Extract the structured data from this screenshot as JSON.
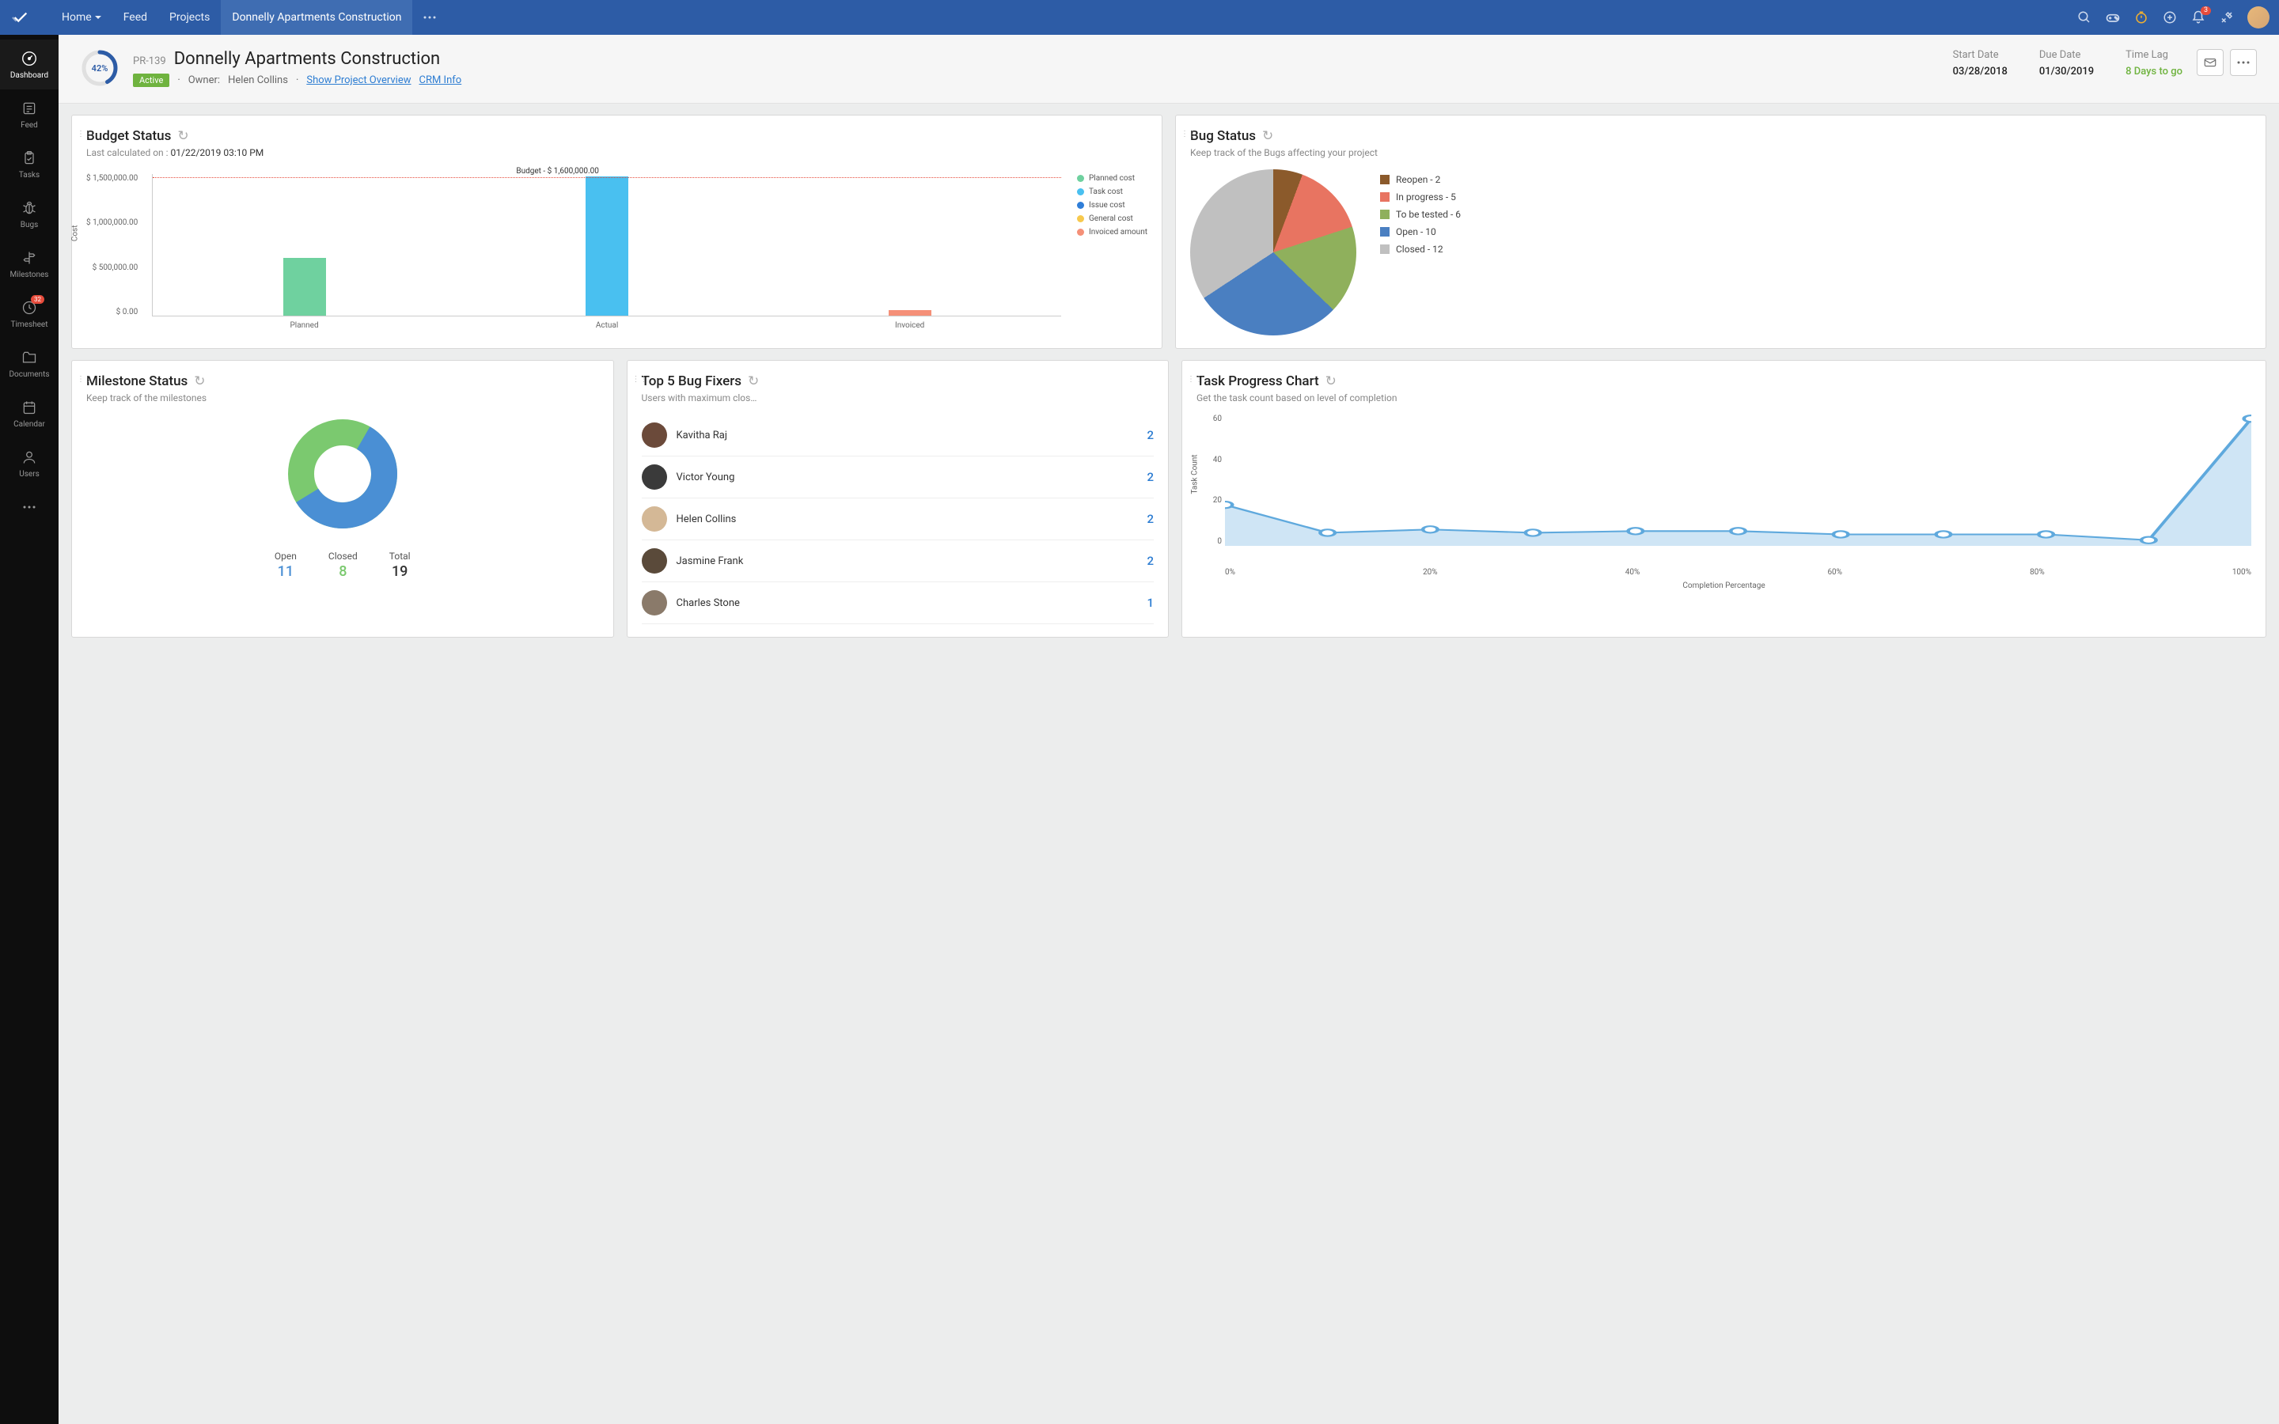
{
  "topbar": {
    "nav": [
      "Home",
      "Feed",
      "Projects",
      "Donnelly Apartments Construction"
    ],
    "notification_count": "3"
  },
  "sidebar": {
    "items": [
      {
        "label": "Dashboard",
        "icon": "gauge"
      },
      {
        "label": "Feed",
        "icon": "feed"
      },
      {
        "label": "Tasks",
        "icon": "clipboard"
      },
      {
        "label": "Bugs",
        "icon": "bug"
      },
      {
        "label": "Milestones",
        "icon": "signpost"
      },
      {
        "label": "Timesheet",
        "icon": "clock",
        "badge": "32"
      },
      {
        "label": "Documents",
        "icon": "folder"
      },
      {
        "label": "Calendar",
        "icon": "calendar"
      },
      {
        "label": "Users",
        "icon": "user"
      }
    ]
  },
  "project": {
    "progress_pct": "42%",
    "id": "PR-139",
    "title": "Donnelly Apartments Construction",
    "status": "Active",
    "owner_label": "Owner:",
    "owner_name": "Helen Collins",
    "overview_link": "Show Project Overview",
    "crm_link": "CRM Info",
    "start_label": "Start Date",
    "start_val": "03/28/2018",
    "due_label": "Due Date",
    "due_val": "01/30/2019",
    "lag_label": "Time Lag",
    "lag_val": "8 Days to go"
  },
  "budget": {
    "title": "Budget Status",
    "calc_prefix": "Last calculated on : ",
    "calc_time": "01/22/2019 03:10 PM",
    "budget_label": "Budget - $ 1,600,000.00",
    "ylabel": "Cost",
    "ticks": [
      "$ 1,500,000.00",
      "$ 1,000,000.00",
      "$ 500,000.00",
      "$ 0.00"
    ],
    "legend": [
      "Planned cost",
      "Task cost",
      "Issue cost",
      "General cost",
      "Invoiced amount"
    ],
    "legend_colors": [
      "#6fd19f",
      "#49c0f0",
      "#2f7ed8",
      "#f7c94d",
      "#f59078"
    ]
  },
  "bugstatus": {
    "title": "Bug Status",
    "sub": "Keep track of the Bugs affecting your project",
    "legend": [
      {
        "label": "Reopen - 2",
        "color": "#8b5a2b"
      },
      {
        "label": "In progress - 5",
        "color": "#e87461"
      },
      {
        "label": "To be tested - 6",
        "color": "#8fb05c"
      },
      {
        "label": "Open - 10",
        "color": "#4a7fc1"
      },
      {
        "label": "Closed - 12",
        "color": "#c0c0c0"
      }
    ]
  },
  "milestone": {
    "title": "Milestone Status",
    "sub": "Keep track of the milestones",
    "stats": [
      {
        "label": "Open",
        "value": "11",
        "cls": "blue"
      },
      {
        "label": "Closed",
        "value": "8",
        "cls": "green"
      },
      {
        "label": "Total",
        "value": "19",
        "cls": "dark"
      }
    ]
  },
  "fixers": {
    "title": "Top 5 Bug Fixers",
    "sub": "Users with maximum clos…",
    "rows": [
      {
        "name": "Kavitha Raj",
        "count": "2",
        "bg": "#6b4a3a"
      },
      {
        "name": "Victor Young",
        "count": "2",
        "bg": "#3a3a3a"
      },
      {
        "name": "Helen Collins",
        "count": "2",
        "bg": "#d4b896"
      },
      {
        "name": "Jasmine Frank",
        "count": "2",
        "bg": "#5a4a3a"
      },
      {
        "name": "Charles Stone",
        "count": "1",
        "bg": "#8a7a6a"
      }
    ]
  },
  "taskprogress": {
    "title": "Task Progress Chart",
    "sub": "Get the task count based on level of completion",
    "ylabel": "Task Count",
    "xlabel": "Completion Percentage",
    "yticks": [
      "60",
      "40",
      "20",
      "0"
    ],
    "xticks": [
      "0%",
      "20%",
      "40%",
      "60%",
      "80%",
      "100%"
    ]
  },
  "chart_data": [
    {
      "id": "budget_status",
      "type": "bar",
      "title": "Budget Status",
      "ylabel": "Cost",
      "ylim": [
        0,
        1600000
      ],
      "budget_line": 1600000,
      "categories": [
        "Planned",
        "Actual",
        "Invoiced"
      ],
      "values": [
        650000,
        1580000,
        60000
      ],
      "colors": [
        "#6fd19f",
        "#49c0f0",
        "#f59078"
      ],
      "legend": [
        "Planned cost",
        "Task cost",
        "Issue cost",
        "General cost",
        "Invoiced amount"
      ]
    },
    {
      "id": "bug_status",
      "type": "pie",
      "title": "Bug Status",
      "series": [
        {
          "name": "Reopen",
          "value": 2,
          "color": "#8b5a2b"
        },
        {
          "name": "In progress",
          "value": 5,
          "color": "#e87461"
        },
        {
          "name": "To be tested",
          "value": 6,
          "color": "#8fb05c"
        },
        {
          "name": "Open",
          "value": 10,
          "color": "#4a7fc1"
        },
        {
          "name": "Closed",
          "value": 12,
          "color": "#c0c0c0"
        }
      ]
    },
    {
      "id": "milestone_status",
      "type": "pie",
      "variant": "donut",
      "title": "Milestone Status",
      "series": [
        {
          "name": "Open",
          "value": 11,
          "color": "#4a8fd4"
        },
        {
          "name": "Closed",
          "value": 8,
          "color": "#7bc96f"
        }
      ],
      "total": 19
    },
    {
      "id": "task_progress",
      "type": "area",
      "title": "Task Progress Chart",
      "xlabel": "Completion Percentage",
      "ylabel": "Task Count",
      "xlim": [
        0,
        100
      ],
      "ylim": [
        0,
        70
      ],
      "x": [
        0,
        10,
        20,
        30,
        40,
        50,
        60,
        70,
        80,
        90,
        100
      ],
      "y": [
        22,
        7,
        9,
        7,
        8,
        8,
        6,
        6,
        6,
        3,
        68
      ]
    }
  ]
}
